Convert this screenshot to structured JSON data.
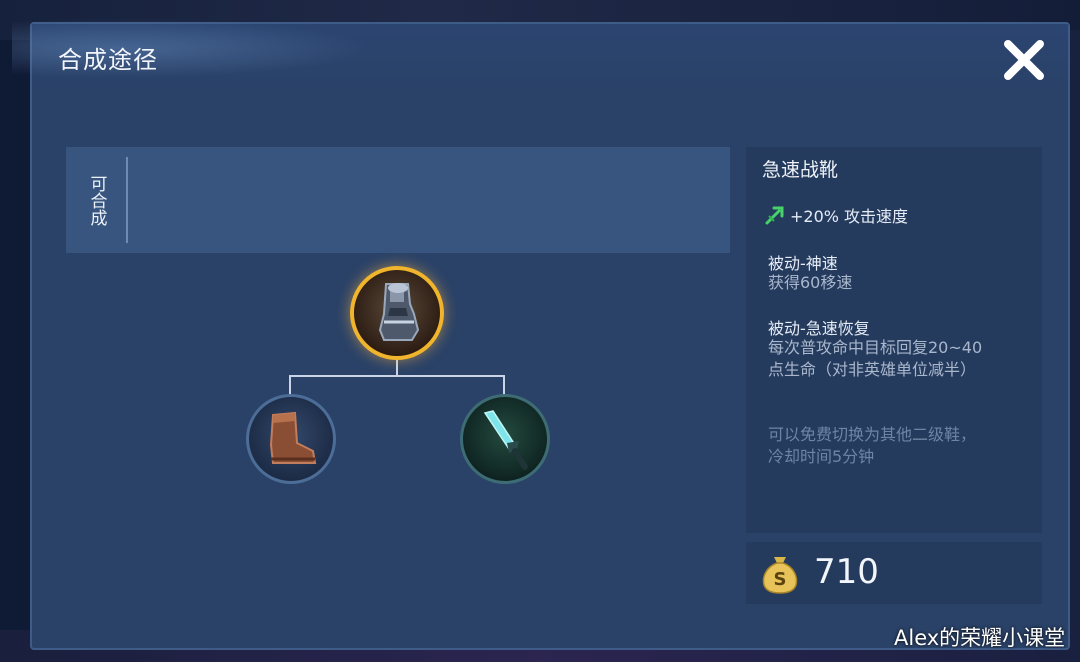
{
  "dialog": {
    "title": "合成途径",
    "close_icon": "close-icon"
  },
  "craftable": {
    "label": "可合成"
  },
  "recipe_tree": {
    "result": {
      "name": "急速战靴",
      "icon": "boots-armored-icon"
    },
    "components": [
      {
        "icon": "leather-boots-icon"
      },
      {
        "icon": "dagger-icon"
      }
    ]
  },
  "item_detail": {
    "name": "急速战靴",
    "stat_icon": "attack-speed-icon",
    "stat": "+20% 攻击速度",
    "passives": [
      {
        "title": "被动-神速",
        "lines": [
          "获得60移速"
        ]
      },
      {
        "title": "被动-急速恢复",
        "lines": [
          "每次普攻命中目标回复20~40",
          "点生命（对非英雄单位减半）"
        ]
      }
    ],
    "note_lines": [
      "可以免费切换为其他二级鞋，",
      "冷却时间5分钟"
    ]
  },
  "price": {
    "icon": "money-bag-icon",
    "value": "710"
  },
  "watermark": "Alex的荣耀小课堂",
  "colors": {
    "panel": "#2a4268",
    "detail_panel": "#253b5e",
    "highlight_border": "#f0b52c",
    "text_primary": "#eef2f8",
    "text_secondary": "#a9b7cc",
    "text_muted": "#6f84a3"
  }
}
